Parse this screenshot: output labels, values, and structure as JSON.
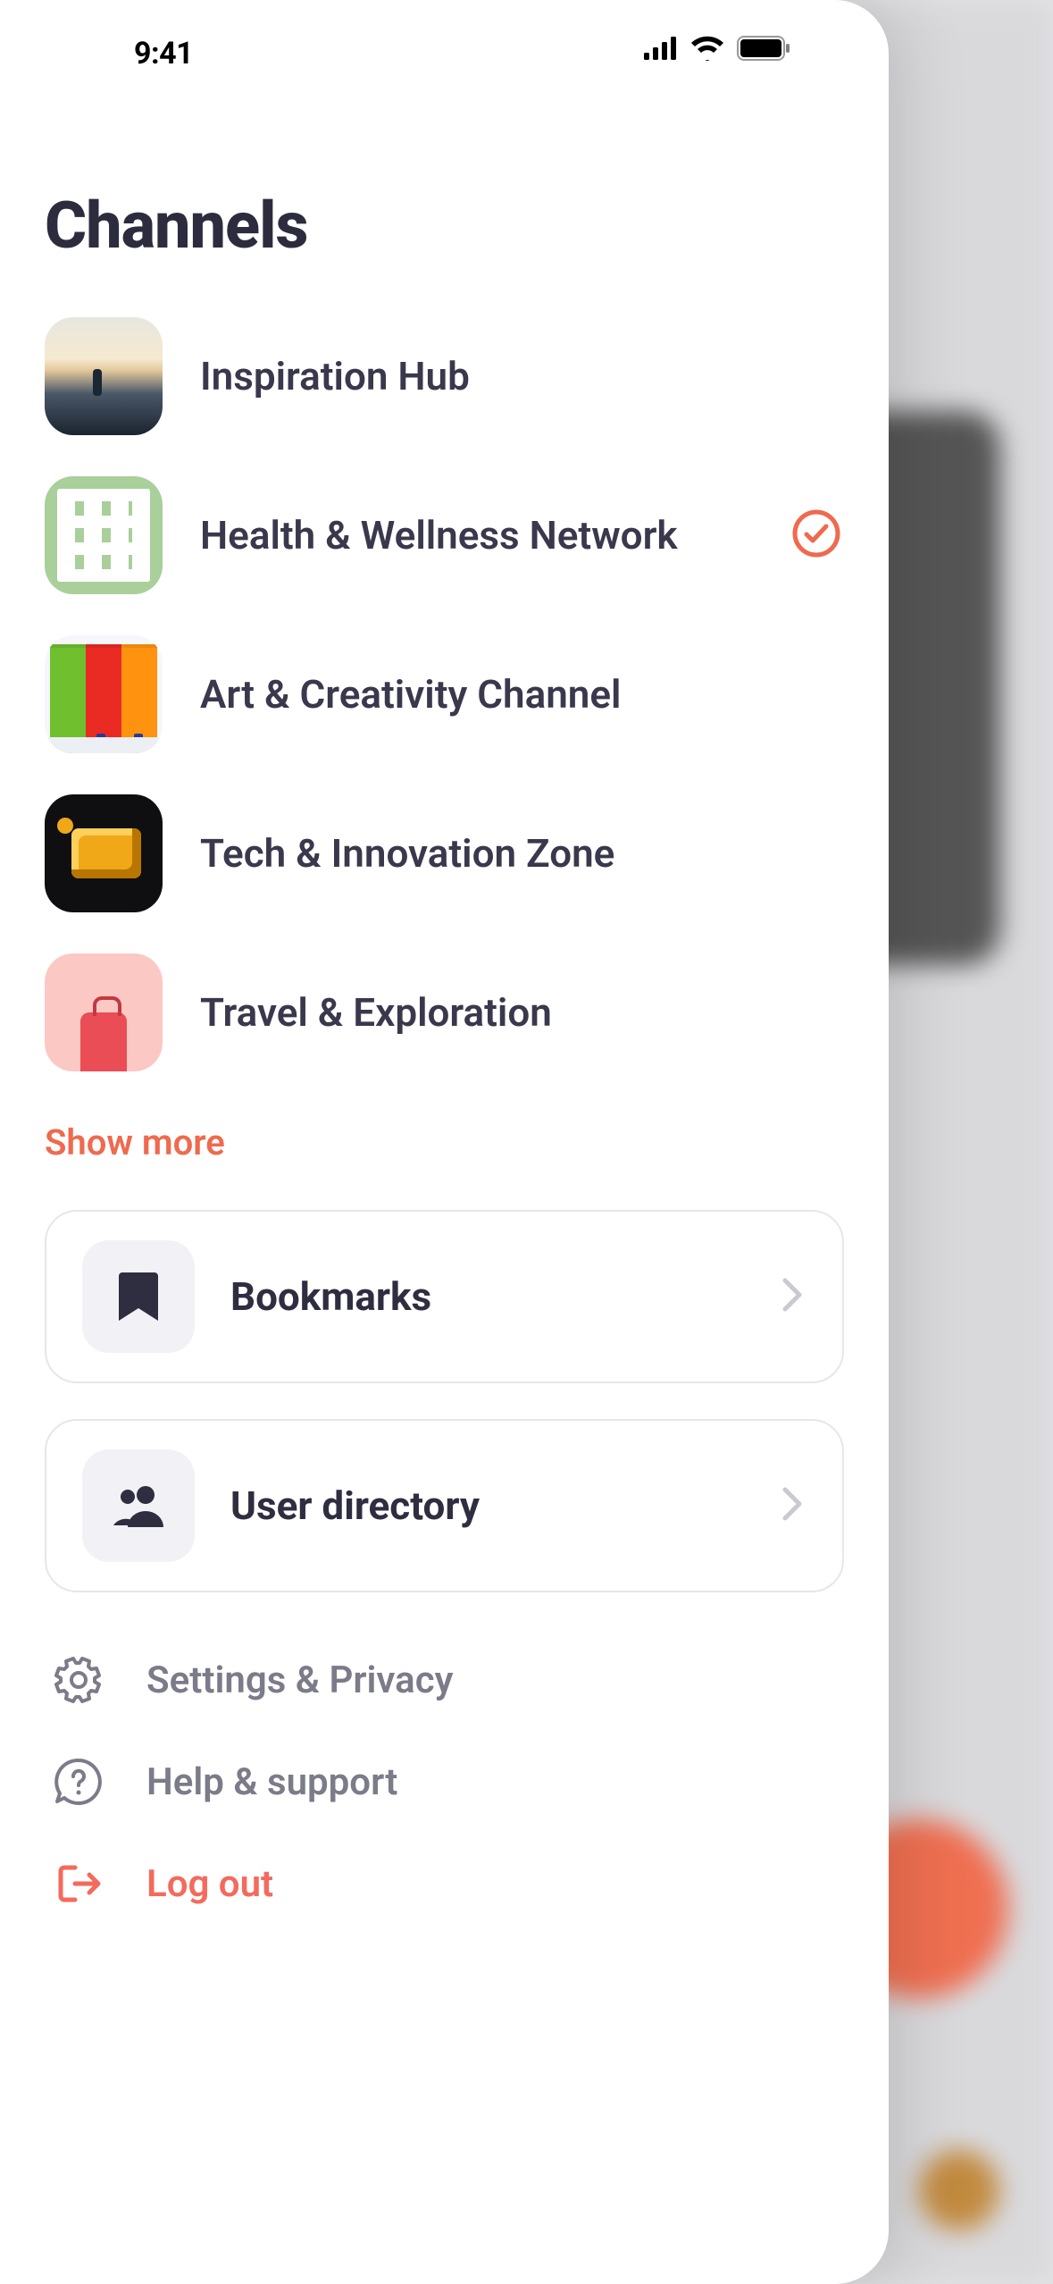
{
  "status": {
    "time": "9:41"
  },
  "title": "Channels",
  "accent": "#ef6a4e",
  "channels": [
    {
      "name": "Inspiration Hub",
      "selected": false
    },
    {
      "name": "Health & Wellness Network",
      "selected": true
    },
    {
      "name": "Art & Creativity Channel",
      "selected": false
    },
    {
      "name": "Tech & Innovation Zone",
      "selected": false
    },
    {
      "name": "Travel & Exploration",
      "selected": false
    }
  ],
  "show_more": "Show more",
  "cards": {
    "bookmarks": {
      "label": "Bookmarks"
    },
    "user_directory": {
      "label": "User directory"
    }
  },
  "links": {
    "settings": "Settings & Privacy",
    "help": "Help & support",
    "logout": "Log out"
  }
}
